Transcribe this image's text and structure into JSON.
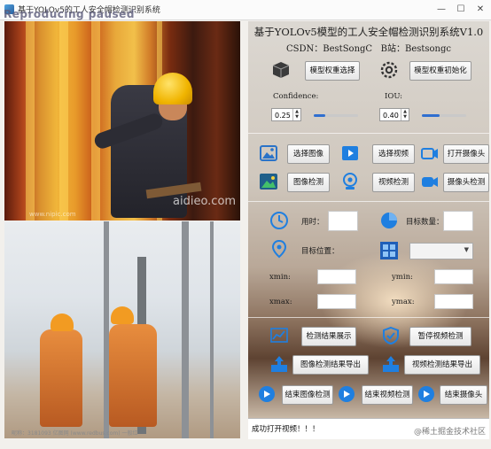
{
  "window": {
    "title": "基于YOLOv5的工人安全帽检测识别系统",
    "overlay": "Reproducing paused",
    "minimize": "—",
    "maximize": "☐",
    "close": "✕"
  },
  "video_top": {
    "watermark_logo": "aidieo.com",
    "watermark_url": "www.nipic.com"
  },
  "video_bottom": {
    "watermark": "昵称：3181093    亿图网 (www.redbus.com)    一般红"
  },
  "header": {
    "title": "基于YOLOv5模型的工人安全帽检测识别系统V1.0",
    "csdn_label": "CSDN：",
    "csdn_value": "BestSongC",
    "bili_label": "B站：",
    "bili_value": "Bestsongc"
  },
  "model": {
    "select_label": "模型权重选择",
    "init_label": "模型权重初始化"
  },
  "params": {
    "confidence_label": "Confidence:",
    "confidence_value": "0.25",
    "confidence_fraction": 0.25,
    "iou_label": "IOU:",
    "iou_value": "0.40",
    "iou_fraction": 0.4
  },
  "inputs": {
    "select_image": "选择图像",
    "select_video": "选择视频",
    "open_camera": "打开摄像头",
    "image_detect": "图像检测",
    "video_detect": "视频检测",
    "camera_detect": "摄像头检测"
  },
  "results": {
    "time_label": "用时：",
    "count_label": "目标数量：",
    "position_label": "目标位置：",
    "xmin_label": "xmin:",
    "ymin_label": "ymin:",
    "xmax_label": "xmax:",
    "ymax_label": "ymax:"
  },
  "actions": {
    "show_results": "检测结果展示",
    "pause_video": "暂停视频检测",
    "export_image": "图像检测结果导出",
    "export_video": "视频检测结果导出",
    "end_image": "结束图像检测",
    "end_video": "结束视频检测",
    "end_camera": "结束摄像头"
  },
  "status": {
    "message": "成功打开视频！！！"
  },
  "footer": {
    "watermark": "@稀土掘金技术社区"
  },
  "colors": {
    "accent": "#2f6fd0",
    "helmet": "#f0b400"
  }
}
